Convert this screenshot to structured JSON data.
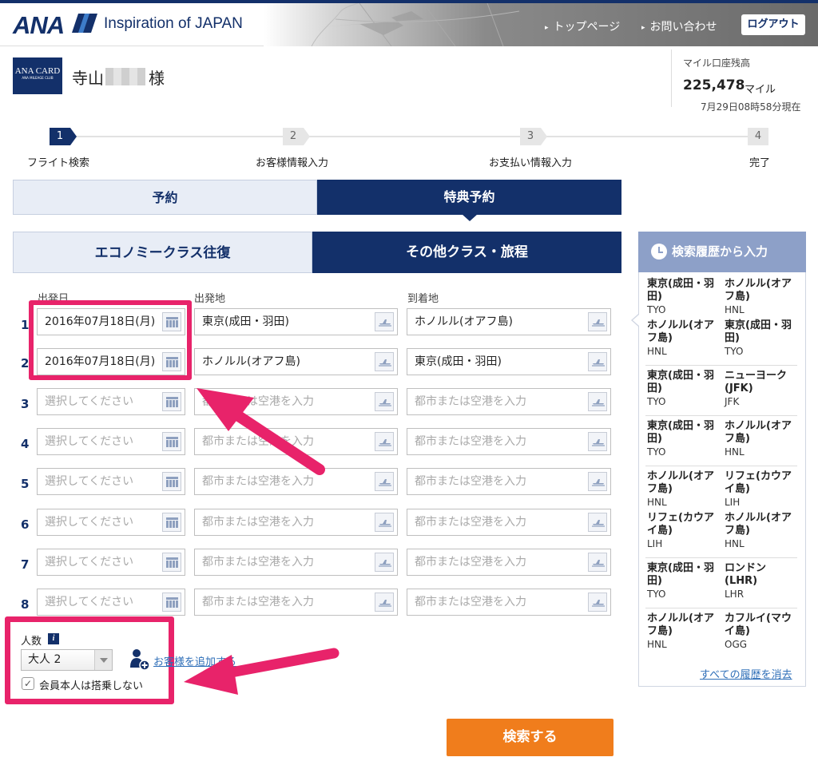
{
  "header": {
    "logo": "ANA",
    "tagline": "Inspiration of JAPAN",
    "links": [
      "トップページ",
      "お問い合わせ"
    ],
    "logout": "ログアウト"
  },
  "user": {
    "card_line1": "ANA CARD",
    "card_line2": "ANA MILEAGE CLUB",
    "name": "寺山",
    "honorific": "様",
    "miles_label": "マイル口座残高",
    "miles_value": "225,478",
    "miles_unit": "マイル",
    "as_of": "7月29日08時58分現在"
  },
  "steps": [
    {
      "num": "1",
      "label": "フライト検索"
    },
    {
      "num": "2",
      "label": "お客様情報入力"
    },
    {
      "num": "3",
      "label": "お支払い情報入力"
    },
    {
      "num": "4",
      "label": "完了"
    }
  ],
  "tabs": {
    "reserve": "予約",
    "award": "特典予約"
  },
  "subtabs": {
    "economy": "エコノミークラス往復",
    "other": "その他クラス・旅程"
  },
  "form": {
    "col_date": "出発日",
    "col_from": "出発地",
    "col_to": "到着地",
    "rows": [
      {
        "n": "1",
        "date": "2016年07月18日(月)",
        "from": "東京(成田・羽田)",
        "to": "ホノルル(オアフ島)"
      },
      {
        "n": "2",
        "date": "2016年07月18日(月)",
        "from": "ホノルル(オアフ島)",
        "to": "東京(成田・羽田)"
      },
      {
        "n": "3"
      },
      {
        "n": "4"
      },
      {
        "n": "5"
      },
      {
        "n": "6"
      },
      {
        "n": "7"
      },
      {
        "n": "8"
      }
    ],
    "date_placeholder": "選択してください",
    "city_placeholder": "都市または空港を入力"
  },
  "pax": {
    "label": "人数",
    "info": "i",
    "value": "大人 2",
    "add_link": "お客様を追加する",
    "not_boarding": "会員本人は搭乗しない",
    "check_mark": "✓"
  },
  "search_button": "検索する",
  "history": {
    "title": "検索履歴から入力",
    "groups": [
      [
        {
          "from": "東京(成田・羽田)",
          "fc": "TYO",
          "to": "ホノルル(オアフ島)",
          "tc": "HNL"
        },
        {
          "from": "ホノルル(オアフ島)",
          "fc": "HNL",
          "to": "東京(成田・羽田)",
          "tc": "TYO"
        }
      ],
      [
        {
          "from": "東京(成田・羽田)",
          "fc": "TYO",
          "to": "ニューヨーク(JFK)",
          "tc": "JFK"
        }
      ],
      [
        {
          "from": "東京(成田・羽田)",
          "fc": "TYO",
          "to": "ホノルル(オアフ島)",
          "tc": "HNL"
        }
      ],
      [
        {
          "from": "ホノルル(オアフ島)",
          "fc": "HNL",
          "to": "リフェ(カウアイ島)",
          "tc": "LIH"
        },
        {
          "from": "リフェ(カウアイ島)",
          "fc": "LIH",
          "to": "ホノルル(オアフ島)",
          "tc": "HNL"
        }
      ],
      [
        {
          "from": "東京(成田・羽田)",
          "fc": "TYO",
          "to": "ロンドン(LHR)",
          "tc": "LHR"
        }
      ],
      [
        {
          "from": "ホノルル(オアフ島)",
          "fc": "HNL",
          "to": "カフルイ(マウイ島)",
          "tc": "OGG"
        }
      ]
    ],
    "clear_all": "すべての履歴を消去"
  },
  "colors": {
    "navy": "#13306a",
    "accent_pink": "#e8236a",
    "search_orange": "#f07d1c",
    "history_header": "#8da0c8"
  }
}
